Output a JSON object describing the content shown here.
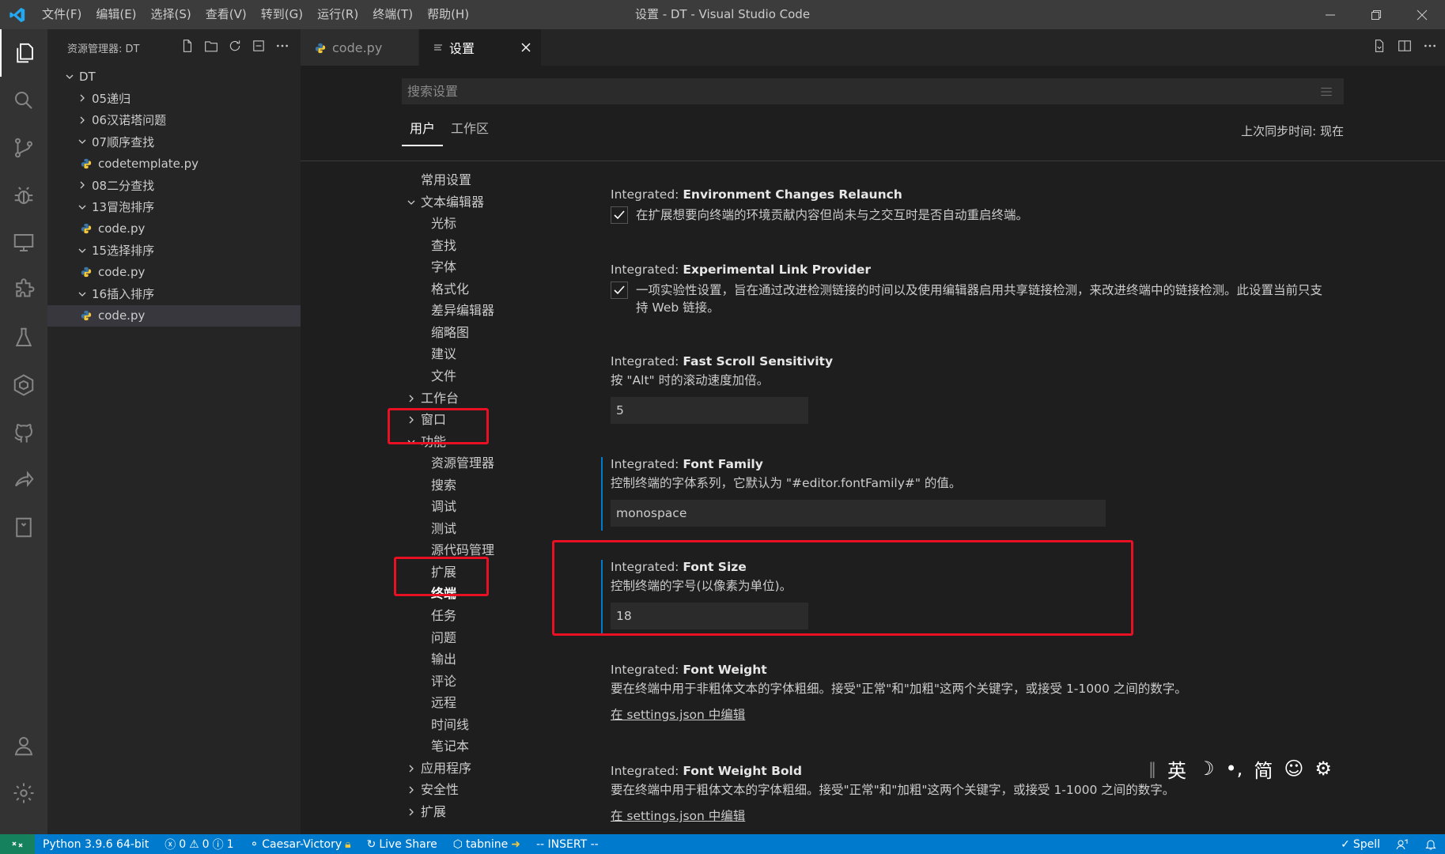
{
  "window": {
    "title": "设置 - DT - Visual Studio Code",
    "menu": [
      "文件(F)",
      "编辑(E)",
      "选择(S)",
      "查看(V)",
      "转到(G)",
      "运行(R)",
      "终端(T)",
      "帮助(H)"
    ]
  },
  "activity_bar": [
    "files-icon",
    "search-icon",
    "source-control-icon",
    "debug-icon",
    "remote-explorer-icon",
    "extensions-icon",
    "testing-icon",
    "live-share-icon",
    "github-icon",
    "share-icon",
    "bookmark-icon",
    "account-icon",
    "settings-gear-icon"
  ],
  "sidebar": {
    "header": "资源管理器: DT",
    "root": "DT",
    "items": [
      {
        "label": "05递归",
        "type": "folder",
        "expanded": false,
        "indent": 1
      },
      {
        "label": "06汉诺塔问题",
        "type": "folder",
        "expanded": false,
        "indent": 1
      },
      {
        "label": "07顺序查找",
        "type": "folder",
        "expanded": true,
        "indent": 1
      },
      {
        "label": "codetemplate.py",
        "type": "file",
        "indent": 2
      },
      {
        "label": "08二分查找",
        "type": "folder",
        "expanded": false,
        "indent": 1
      },
      {
        "label": "13冒泡排序",
        "type": "folder",
        "expanded": true,
        "indent": 1
      },
      {
        "label": "code.py",
        "type": "file",
        "indent": 2
      },
      {
        "label": "15选择排序",
        "type": "folder",
        "expanded": true,
        "indent": 1
      },
      {
        "label": "code.py",
        "type": "file",
        "indent": 2
      },
      {
        "label": "16插入排序",
        "type": "folder",
        "expanded": true,
        "indent": 1
      },
      {
        "label": "code.py",
        "type": "file",
        "indent": 2,
        "selected": true
      }
    ]
  },
  "tabs": [
    {
      "label": "code.py",
      "active": false
    },
    {
      "label": "设置",
      "active": true
    }
  ],
  "settings": {
    "search_placeholder": "搜索设置",
    "scope_user": "用户",
    "scope_workspace": "工作区",
    "sync_time": "上次同步时间: 现在",
    "toc": [
      {
        "label": "常用设置",
        "level": 0,
        "chev": "none"
      },
      {
        "label": "文本编辑器",
        "level": 0,
        "chev": "down"
      },
      {
        "label": "光标",
        "level": 1
      },
      {
        "label": "查找",
        "level": 1
      },
      {
        "label": "字体",
        "level": 1
      },
      {
        "label": "格式化",
        "level": 1
      },
      {
        "label": "差异编辑器",
        "level": 1
      },
      {
        "label": "缩略图",
        "level": 1
      },
      {
        "label": "建议",
        "level": 1
      },
      {
        "label": "文件",
        "level": 1
      },
      {
        "label": "工作台",
        "level": 0,
        "chev": "right"
      },
      {
        "label": "窗口",
        "level": 0,
        "chev": "right"
      },
      {
        "label": "功能",
        "level": 0,
        "chev": "down"
      },
      {
        "label": "资源管理器",
        "level": 1
      },
      {
        "label": "搜索",
        "level": 1
      },
      {
        "label": "调试",
        "level": 1
      },
      {
        "label": "测试",
        "level": 1
      },
      {
        "label": "源代码管理",
        "level": 1
      },
      {
        "label": "扩展",
        "level": 1
      },
      {
        "label": "终端",
        "level": 1,
        "bold": true
      },
      {
        "label": "任务",
        "level": 1
      },
      {
        "label": "问题",
        "level": 1
      },
      {
        "label": "输出",
        "level": 1
      },
      {
        "label": "评论",
        "level": 1
      },
      {
        "label": "远程",
        "level": 1
      },
      {
        "label": "时间线",
        "level": 1
      },
      {
        "label": "笔记本",
        "level": 1
      },
      {
        "label": "应用程序",
        "level": 0,
        "chev": "right"
      },
      {
        "label": "安全性",
        "level": 0,
        "chev": "right"
      },
      {
        "label": "扩展",
        "level": 0,
        "chev": "right"
      }
    ],
    "items": [
      {
        "prefix": "Integrated: ",
        "name": "Environment Changes Relaunch",
        "desc": "在扩展想要向终端的环境贡献内容但尚未与之交互时是否自动重启终端。",
        "kind": "checkbox"
      },
      {
        "prefix": "Integrated: ",
        "name": "Experimental Link Provider",
        "desc": "一项实验性设置，旨在通过改进检测链接的时间以及使用编辑器启用共享链接检测，来改进终端中的链接检测。此设置当前只支持 Web 链接。",
        "kind": "checkbox"
      },
      {
        "prefix": "Integrated: ",
        "name": "Fast Scroll Sensitivity",
        "desc": "按 \"Alt\" 时的滚动速度加倍。",
        "kind": "input",
        "value": "5"
      },
      {
        "prefix": "Integrated: ",
        "name": "Font Family",
        "desc": "控制终端的字体系列，它默认为 \"#editor.fontFamily#\" 的值。",
        "kind": "input",
        "value": "monospace"
      },
      {
        "prefix": "Integrated: ",
        "name": "Font Size",
        "desc": "控制终端的字号(以像素为单位)。",
        "kind": "input",
        "value": "18"
      },
      {
        "prefix": "Integrated: ",
        "name": "Font Weight",
        "desc": "要在终端中用于非粗体文本的字体粗细。接受\"正常\"和\"加粗\"这两个关键字，或接受 1-1000 之间的数字。",
        "kind": "link",
        "link": "在 settings.json 中编辑"
      },
      {
        "prefix": "Integrated: ",
        "name": "Font Weight Bold",
        "desc": "要在终端中用于粗体文本的字体粗细。接受\"正常\"和\"加粗\"这两个关键字，或接受 1-1000 之间的数字。",
        "kind": "link",
        "link": "在 settings.json 中编辑"
      }
    ]
  },
  "ime_toolbar": [
    "英",
    "☽",
    "•,",
    "简",
    "☺",
    "⚙"
  ],
  "status_bar": {
    "python": "Python 3.9.6 64-bit",
    "errors": "0",
    "warnings": "0",
    "infos": "1",
    "branch": "Caesar-Victory",
    "live_share": "Live Share",
    "tabnine": "tabnine",
    "mode": "-- INSERT --",
    "spell": "Spell"
  },
  "colors": {
    "accent": "#007acc",
    "highlight_box": "#e81123",
    "remote": "#16825d"
  }
}
